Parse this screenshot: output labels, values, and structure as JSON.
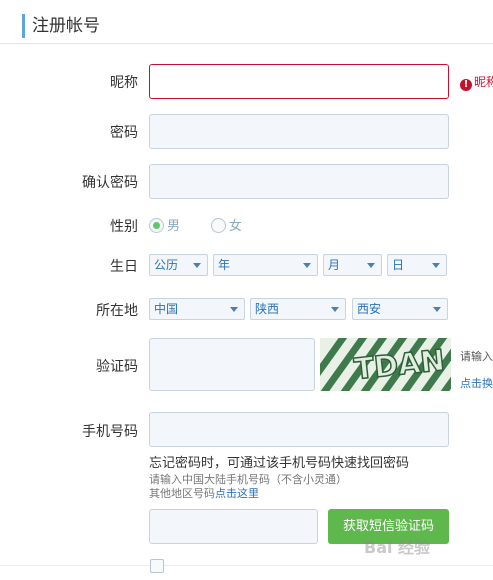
{
  "header": {
    "title": "注册帐号"
  },
  "form": {
    "nickname": {
      "label": "昵称",
      "value": "",
      "error": "昵称"
    },
    "password": {
      "label": "密码",
      "value": ""
    },
    "confirm_password": {
      "label": "确认密码",
      "value": ""
    },
    "gender": {
      "label": "性别",
      "options": [
        "男",
        "女"
      ],
      "selected": "男"
    },
    "birthday": {
      "label": "生日",
      "calendar": "公历",
      "year": "年",
      "month": "月",
      "day": "日"
    },
    "location": {
      "label": "所在地",
      "country": "中国",
      "province": "陕西",
      "city": "西安"
    },
    "captcha": {
      "label": "验证码",
      "value": "",
      "image_text": "TDAN",
      "hint": "请输入",
      "refresh": "点击换"
    },
    "phone": {
      "label": "手机号码",
      "value": "",
      "tip": "忘记密码时，可通过该手机号码快速找回密码",
      "sub_tip": "请输入中国大陆手机号码（不含小灵通）",
      "other_region_prefix": "其他地区号码",
      "other_region_link": "点击这里"
    },
    "sms": {
      "value": "",
      "button": "获取短信验证码"
    }
  },
  "watermark": "Bai 经验",
  "colors": {
    "accent": "#5aa7e0",
    "error": "#c8102e",
    "button": "#5eb84c",
    "link": "#2b73b8"
  }
}
